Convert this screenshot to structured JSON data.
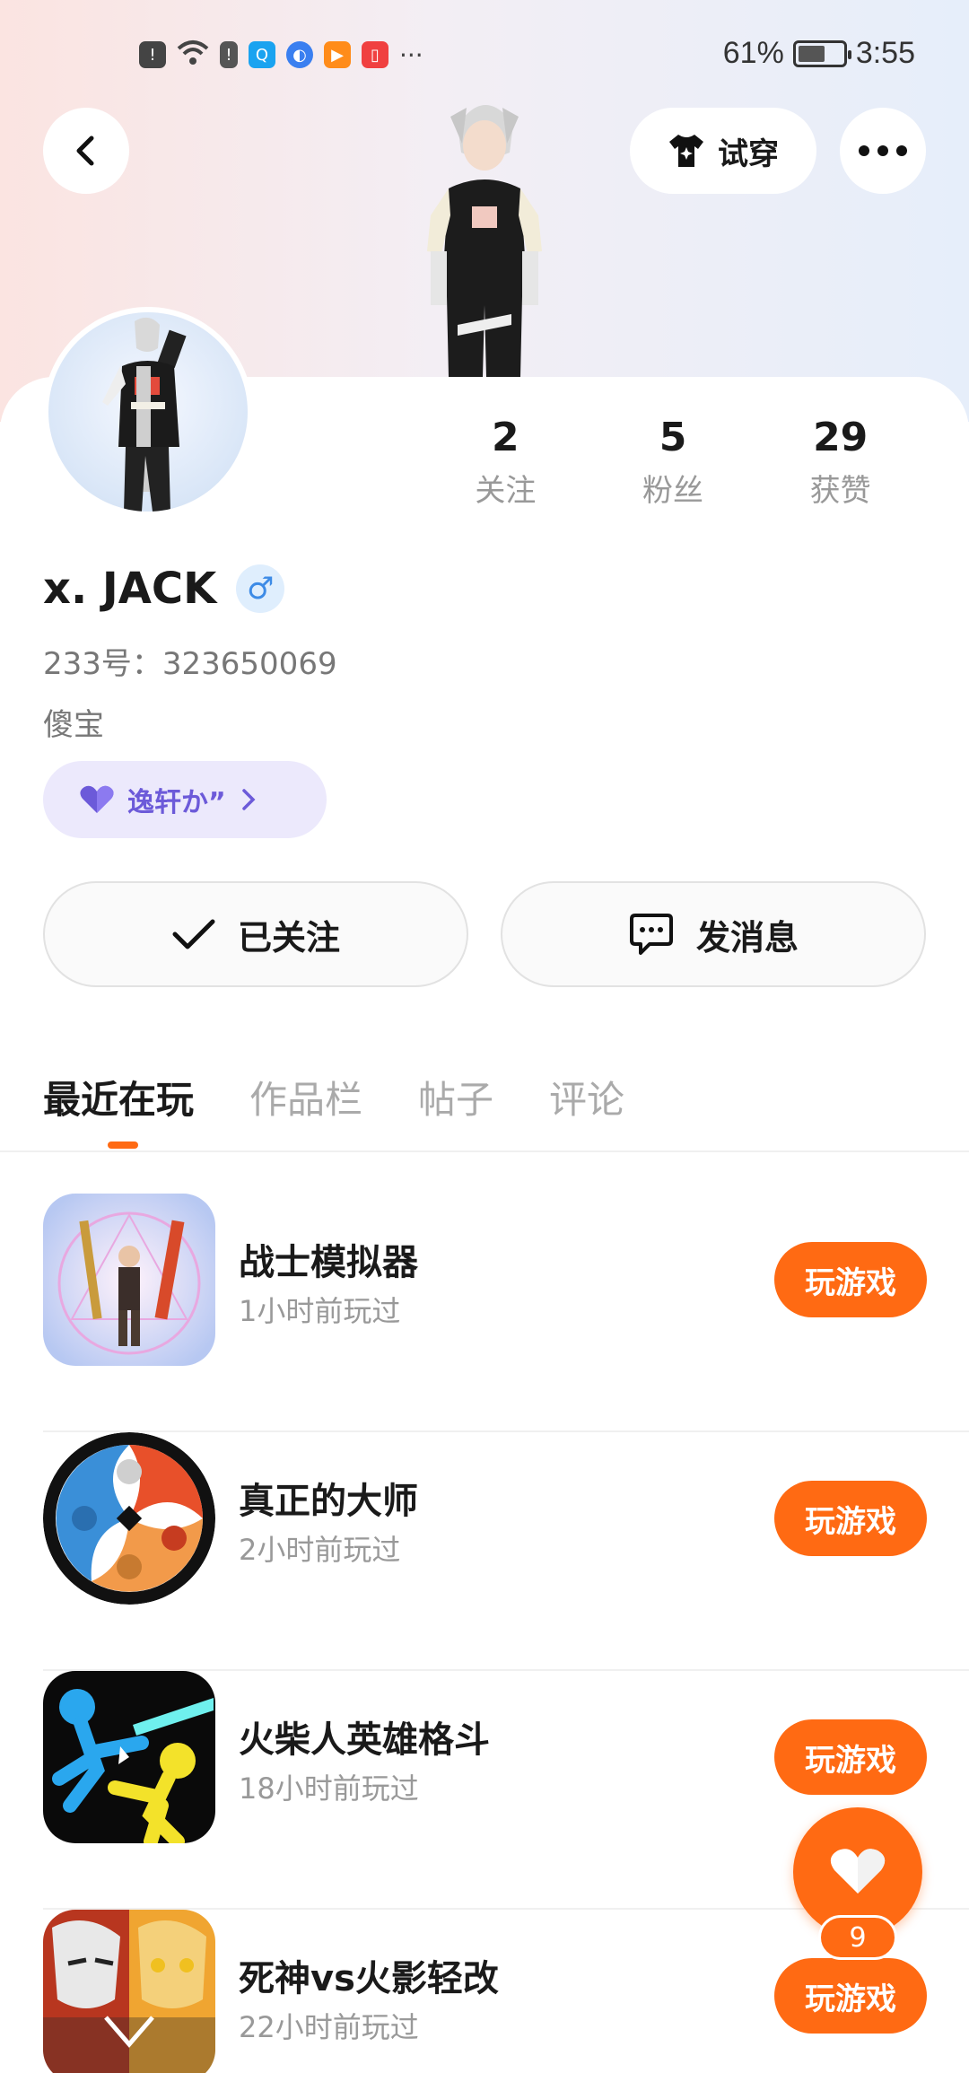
{
  "status_bar": {
    "battery_percent": "61%",
    "time": "3:55",
    "more": "···"
  },
  "header": {
    "back_label": "back",
    "tryon_label": "试穿",
    "more_label": "more"
  },
  "profile": {
    "stats": [
      {
        "num": "2",
        "label": "关注"
      },
      {
        "num": "5",
        "label": "粉丝"
      },
      {
        "num": "29",
        "label": "获赞"
      }
    ],
    "username": "x. JACK",
    "gender_symbol": "♂",
    "user_id": "233号：323650069",
    "bio": "傻宝",
    "tag_label": "逸轩か”"
  },
  "actions": {
    "follow_label": "已关注",
    "message_label": "发消息"
  },
  "tabs": [
    "最近在玩",
    "作品栏",
    "帖子",
    "评论"
  ],
  "games": [
    {
      "name": "战士模拟器",
      "time": "1小时前玩过",
      "button": "玩游戏"
    },
    {
      "name": "真正的大师",
      "time": "2小时前玩过",
      "button": "玩游戏"
    },
    {
      "name": "火柴人英雄格斗",
      "time": "18小时前玩过",
      "button": "玩游戏"
    },
    {
      "name": "死神vs火影轻改",
      "time": "22小时前玩过",
      "button": "玩游戏"
    }
  ],
  "fab": {
    "count": "9"
  },
  "colors": {
    "accent": "#ff6a13",
    "tag_bg": "#ece9fc",
    "tag_text": "#6c5ad9",
    "gender": "#3d8be6"
  }
}
